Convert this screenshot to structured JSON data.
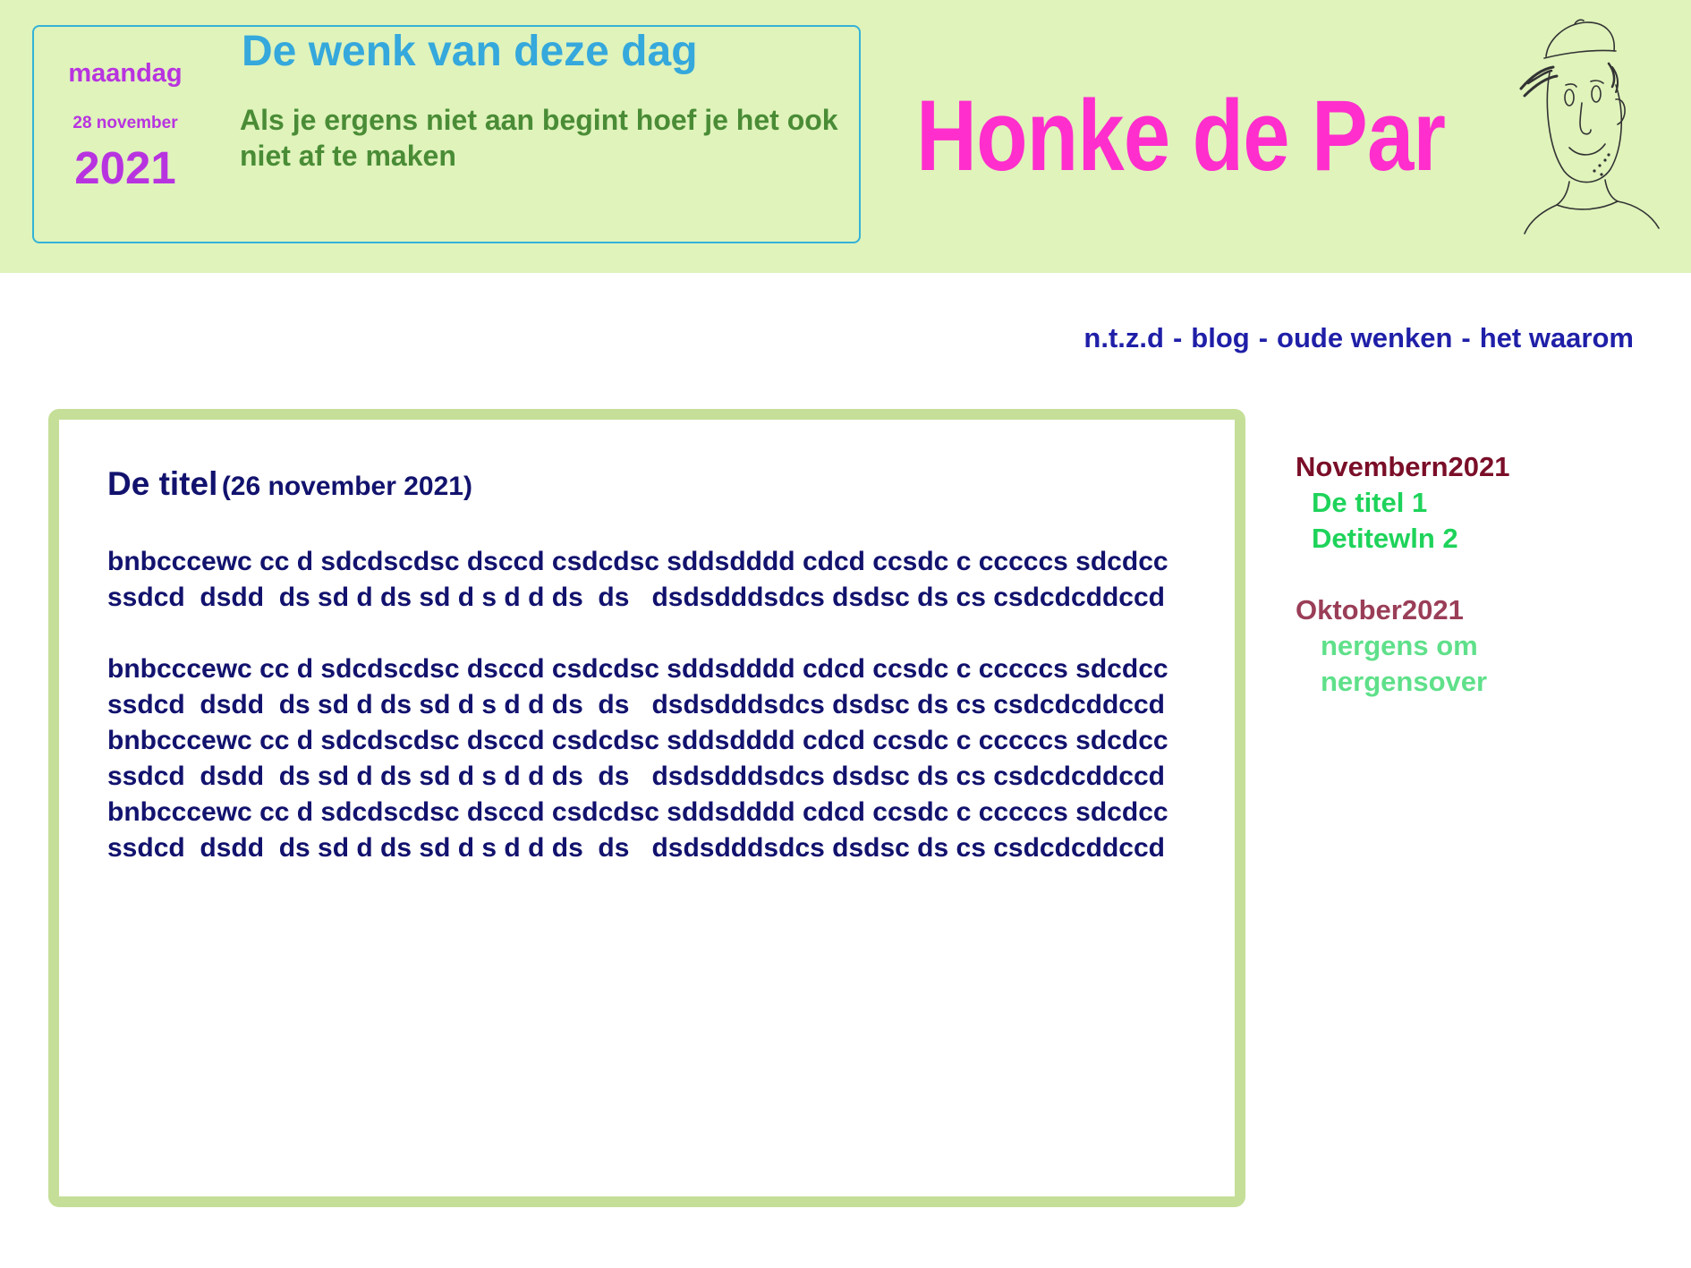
{
  "wenk": {
    "day": "maandag",
    "date": "28 november",
    "year": "2021",
    "title": "De wenk van deze dag",
    "text": "Als je ergens niet aan begint hoef je het ook niet af te maken"
  },
  "site": {
    "title": "Honke de Par"
  },
  "nav": {
    "items": [
      "n.t.z.d",
      "blog",
      "oude wenken",
      "het waarom"
    ],
    "separator": "-"
  },
  "post": {
    "title": "De titel",
    "date": "(26 november 2021)",
    "paragraphs": [
      "bnbcccewc cc d sdcdscdsc dsccd csdcdsc sddsdddd cdcd ccsdc c cccccs sdcdcc ssdcd  dsdd  ds sd d ds sd d s d d ds  ds   dsdsdddsdcs dsdsc ds cs csdcdcddccd",
      "bnbcccewc cc d sdcdscdsc dsccd csdcdsc sddsdddd cdcd ccsdc c cccccs sdcdcc ssdcd  dsdd  ds sd d ds sd d s d d ds  ds   dsdsdddsdcs dsdsc ds cs csdcdcddccd",
      "bnbcccewc cc d sdcdscdsc dsccd csdcdsc sddsdddd cdcd ccsdc c cccccs sdcdcc ssdcd  dsdd  ds sd d ds sd d s d d ds  ds   dsdsdddsdcs dsdsc ds cs csdcdcddccd",
      "bnbcccewc cc d sdcdscdsc dsccd csdcdsc sddsdddd cdcd ccsdc c cccccs sdcdcc ssdcd  dsdd  ds sd d ds sd d s d d ds  ds   dsdsdddsdcs dsdsc ds cs csdcdcddccd"
    ]
  },
  "archive": {
    "months": [
      {
        "label": "Novembern2021",
        "items": [
          "De titel 1",
          "Detitewln 2"
        ]
      },
      {
        "label": "Oktober2021",
        "items": [
          "nergens om",
          "nergensover"
        ]
      }
    ]
  },
  "colors": {
    "header_bg": "#dff3bb",
    "wenk_border": "#35b2d6",
    "date": "#b833e0",
    "wenk_title": "#35a8dc",
    "wenk_text": "#4a8c36",
    "site_title": "#ff2ecc",
    "nav": "#1f1fa8",
    "content_border": "#c5df98",
    "post_text": "#12126e"
  },
  "icons": {
    "avatar": "hand-drawn-face-with-cap"
  }
}
